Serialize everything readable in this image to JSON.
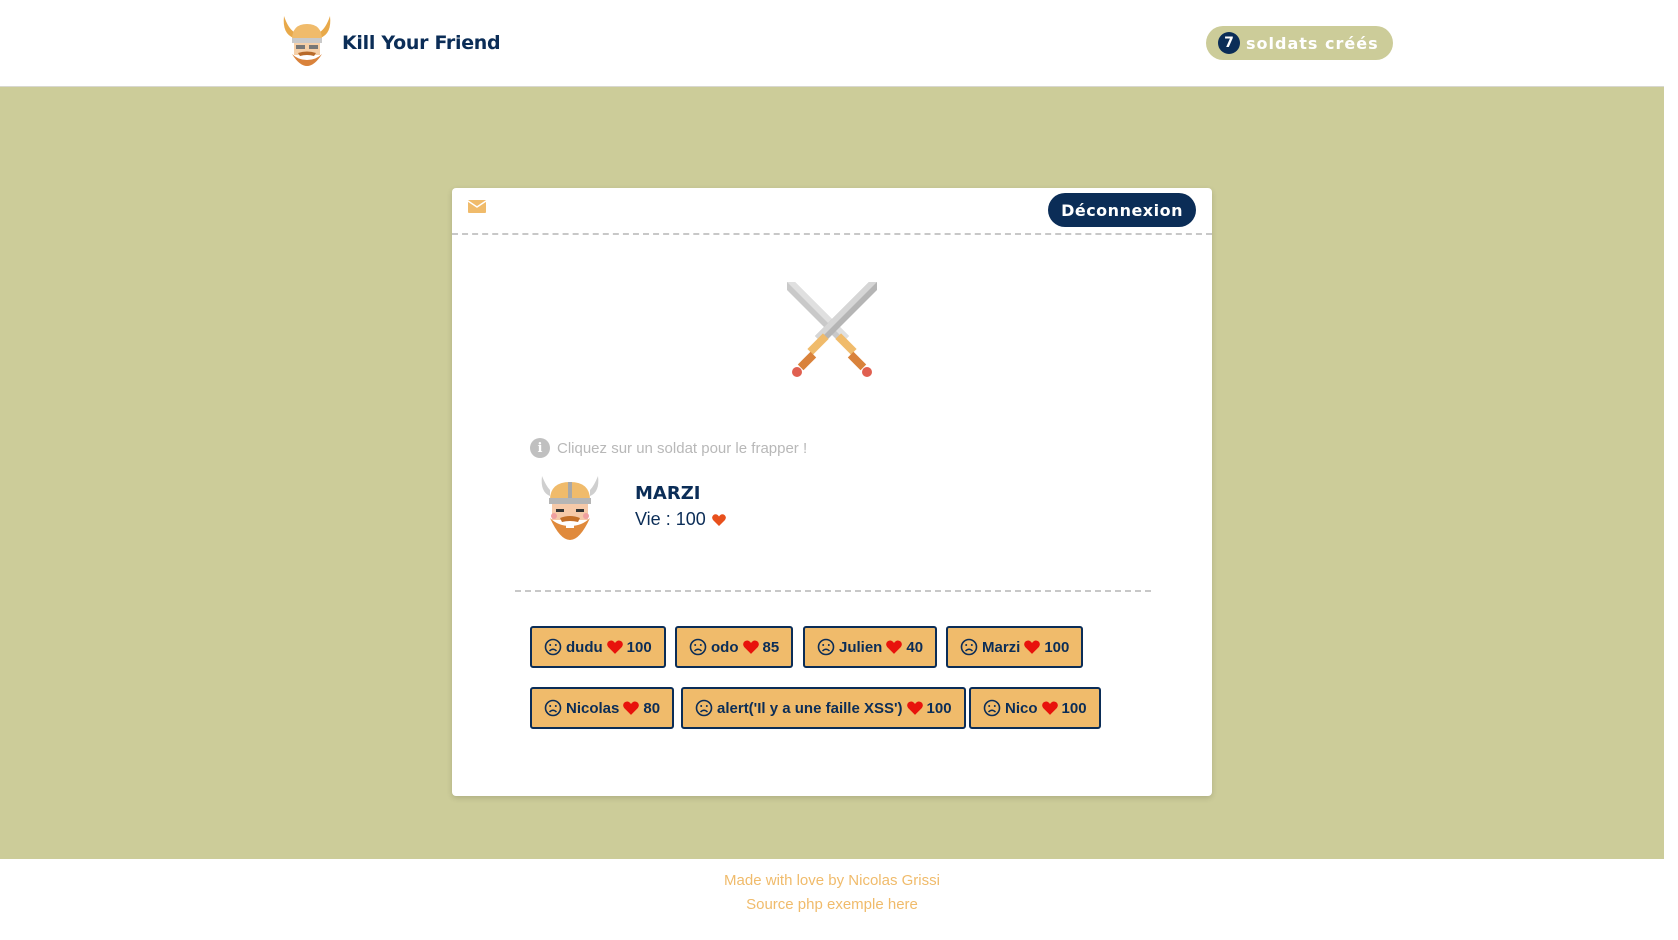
{
  "header": {
    "brand_name": "Kill Your Friend",
    "soldier_count": "7",
    "soldier_count_label": "soldats créés"
  },
  "card": {
    "logout_label": "Déconnexion",
    "hint": "Cliquez sur un soldat pour le frapper !",
    "player": {
      "name": "MARZI",
      "life_label": "Vie : 100"
    },
    "soldiers": [
      {
        "name": "dudu",
        "life": "100"
      },
      {
        "name": "odo",
        "life": "85"
      },
      {
        "name": "Julien",
        "life": "40"
      },
      {
        "name": "Marzi",
        "life": "100"
      },
      {
        "name": "Nicolas",
        "life": "80"
      },
      {
        "name": "alert('Il y a une faille XSS')",
        "life": "100"
      },
      {
        "name": "Nico",
        "life": "100"
      }
    ]
  },
  "footer": {
    "credit": "Made with love by Nicolas Grissi",
    "source_link": "Source php exemple here"
  },
  "colors": {
    "navy": "#0b2d57",
    "olive": "#cccc99",
    "orange": "#f0bb6b",
    "heart_red": "#e8120c"
  },
  "icons": [
    "viking-logo-icon",
    "mail-icon",
    "crossed-swords-icon",
    "info-icon",
    "viking-avatar-icon",
    "frown-face-icon",
    "heart-icon"
  ]
}
